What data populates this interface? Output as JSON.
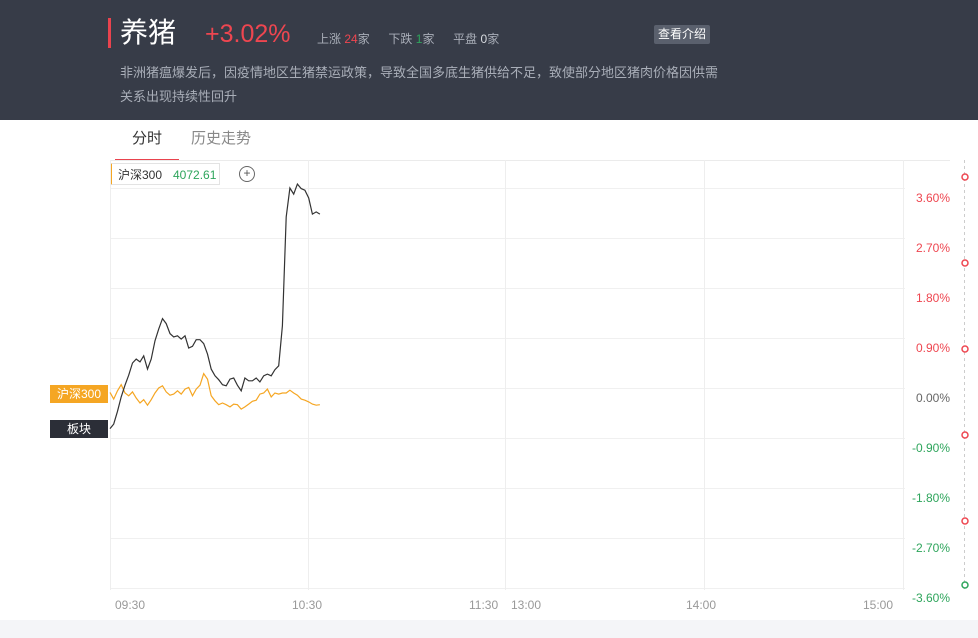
{
  "header": {
    "sector_name": "养猪",
    "change_pct": "+3.02%",
    "up_label": "上涨",
    "up_count": "24",
    "up_unit": "家",
    "down_label": "下跌",
    "down_count": "1",
    "down_unit": "家",
    "flat_label": "平盘",
    "flat_count": "0",
    "flat_unit": "家",
    "intro_button": "查看介绍",
    "description": "非洲猪瘟爆发后，因疫情地区生猪禁运政策，导致全国多底生猪供给不足，致使部分地区猪肉价格因供需关系出现持续性回升"
  },
  "tabs": {
    "intraday": "分时",
    "history": "历史走势"
  },
  "index_box": {
    "name": "沪深300",
    "value": "4072.61",
    "add_symbol": "+"
  },
  "tags": {
    "hs300": "沪深300",
    "sector": "板块"
  },
  "colors": {
    "up": "#ee4650",
    "down": "#2ea55c",
    "hs300_line": "#f5a623",
    "sector_line": "#333333",
    "header_bg": "#373c48"
  },
  "chart_data": {
    "type": "line",
    "x_ticks": [
      "09:30",
      "10:30",
      "11:30",
      "13:00",
      "14:00",
      "15:00"
    ],
    "y_ticks": [
      "3.60%",
      "2.70%",
      "1.80%",
      "0.90%",
      "0.00%",
      "-0.90%",
      "-1.80%",
      "-2.70%",
      "-3.60%"
    ],
    "ylim": [
      -3.6,
      3.6
    ],
    "x_unit": "minutes since 09:30",
    "series": [
      {
        "name": "板块",
        "color": "#333333",
        "points": [
          [
            0,
            -0.73
          ],
          [
            1,
            -0.65
          ],
          [
            2,
            -0.42
          ],
          [
            3,
            -0.16
          ],
          [
            4,
            0.05
          ],
          [
            5,
            0.23
          ],
          [
            6,
            0.45
          ],
          [
            7,
            0.52
          ],
          [
            8,
            0.47
          ],
          [
            9,
            0.58
          ],
          [
            10,
            0.34
          ],
          [
            11,
            0.52
          ],
          [
            12,
            0.85
          ],
          [
            13,
            1.06
          ],
          [
            14,
            1.25
          ],
          [
            15,
            1.16
          ],
          [
            16,
            0.98
          ],
          [
            17,
            0.92
          ],
          [
            18,
            0.94
          ],
          [
            19,
            0.88
          ],
          [
            20,
            0.94
          ],
          [
            21,
            0.72
          ],
          [
            22,
            0.75
          ],
          [
            23,
            0.87
          ],
          [
            24,
            0.87
          ],
          [
            25,
            0.8
          ],
          [
            26,
            0.61
          ],
          [
            27,
            0.34
          ],
          [
            28,
            0.22
          ],
          [
            29,
            0.15
          ],
          [
            30,
            0.06
          ],
          [
            31,
            0.04
          ],
          [
            32,
            0.16
          ],
          [
            33,
            0.18
          ],
          [
            34,
            0.05
          ],
          [
            35,
            -0.05
          ],
          [
            36,
            0.18
          ],
          [
            37,
            0.13
          ],
          [
            38,
            0.13
          ],
          [
            39,
            0.18
          ],
          [
            40,
            0.11
          ],
          [
            41,
            0.22
          ],
          [
            42,
            0.25
          ],
          [
            43,
            0.22
          ],
          [
            44,
            0.33
          ],
          [
            45,
            0.4
          ],
          [
            46,
            1.12
          ],
          [
            47,
            3.08
          ],
          [
            48,
            3.6
          ],
          [
            49,
            3.49
          ],
          [
            50,
            3.67
          ],
          [
            51,
            3.59
          ],
          [
            52,
            3.56
          ],
          [
            53,
            3.42
          ],
          [
            54,
            3.13
          ],
          [
            55,
            3.17
          ],
          [
            56,
            3.13
          ]
        ]
      },
      {
        "name": "沪深300",
        "color": "#f5a623",
        "points": [
          [
            0,
            -0.08
          ],
          [
            1,
            -0.2
          ],
          [
            2,
            -0.05
          ],
          [
            3,
            0.06
          ],
          [
            4,
            -0.09
          ],
          [
            5,
            -0.14
          ],
          [
            6,
            -0.07
          ],
          [
            7,
            -0.18
          ],
          [
            8,
            -0.27
          ],
          [
            9,
            -0.21
          ],
          [
            10,
            -0.31
          ],
          [
            11,
            -0.21
          ],
          [
            12,
            -0.09
          ],
          [
            13,
            0.0
          ],
          [
            14,
            0.04
          ],
          [
            15,
            -0.07
          ],
          [
            16,
            -0.13
          ],
          [
            17,
            -0.11
          ],
          [
            18,
            -0.05
          ],
          [
            19,
            -0.11
          ],
          [
            20,
            -0.02
          ],
          [
            21,
            0.01
          ],
          [
            22,
            -0.14
          ],
          [
            23,
            -0.02
          ],
          [
            24,
            0.05
          ],
          [
            25,
            0.26
          ],
          [
            26,
            0.16
          ],
          [
            27,
            -0.14
          ],
          [
            28,
            -0.23
          ],
          [
            29,
            -0.3
          ],
          [
            30,
            -0.27
          ],
          [
            31,
            -0.3
          ],
          [
            32,
            -0.34
          ],
          [
            33,
            -0.29
          ],
          [
            34,
            -0.3
          ],
          [
            35,
            -0.38
          ],
          [
            36,
            -0.34
          ],
          [
            37,
            -0.29
          ],
          [
            38,
            -0.24
          ],
          [
            39,
            -0.22
          ],
          [
            40,
            -0.11
          ],
          [
            41,
            -0.09
          ],
          [
            42,
            -0.02
          ],
          [
            43,
            -0.16
          ],
          [
            44,
            -0.09
          ],
          [
            45,
            -0.11
          ],
          [
            46,
            -0.09
          ],
          [
            47,
            -0.09
          ],
          [
            48,
            -0.04
          ],
          [
            49,
            -0.09
          ],
          [
            50,
            -0.13
          ],
          [
            51,
            -0.2
          ],
          [
            52,
            -0.22
          ],
          [
            53,
            -0.25
          ],
          [
            54,
            -0.29
          ],
          [
            55,
            -0.31
          ],
          [
            56,
            -0.3
          ]
        ]
      }
    ],
    "right_markers": [
      {
        "color": "up"
      },
      {
        "color": "up"
      },
      {
        "color": "up"
      },
      {
        "color": "up"
      },
      {
        "color": "up"
      },
      {
        "color": "down"
      }
    ]
  }
}
